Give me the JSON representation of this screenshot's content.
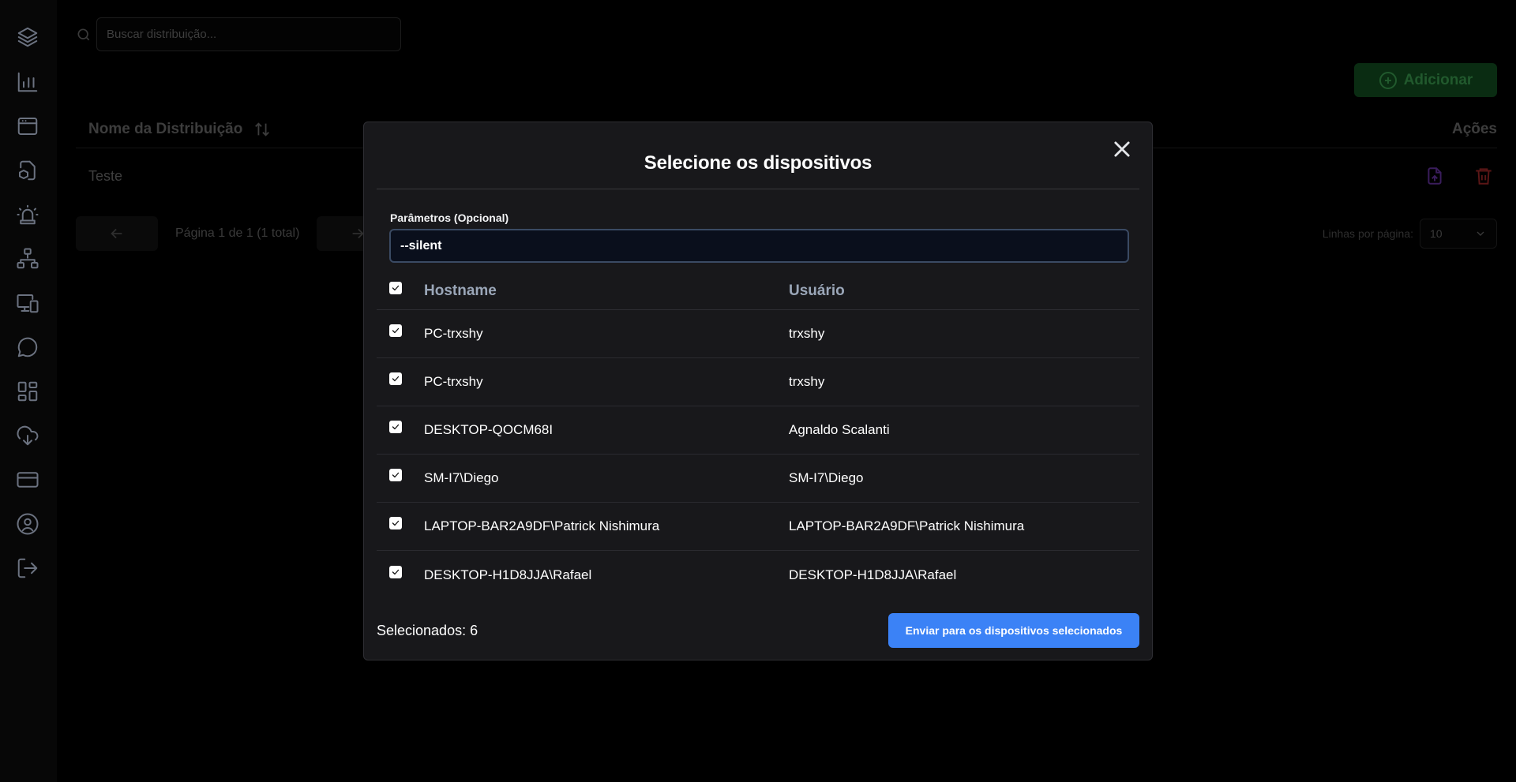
{
  "sidebar": {
    "icons": [
      "layers-icon",
      "bar-chart-icon",
      "browser-window-icon",
      "package-download-icon",
      "siren-alert-icon",
      "network-tree-icon",
      "monitor-devices-icon",
      "chat-bubble-icon",
      "dashboard-grid-icon",
      "cloud-download-icon",
      "credit-card-icon",
      "user-circle-icon",
      "logout-icon"
    ]
  },
  "search": {
    "placeholder": "Buscar distribuição..."
  },
  "add_button": {
    "label": "Adicionar",
    "color": "#22c55e"
  },
  "table": {
    "headers": {
      "name": "Nome da Distribuição",
      "actions": "Ações"
    },
    "rows": [
      {
        "name": "Teste"
      }
    ]
  },
  "pagination": {
    "text": "Página 1 de 1 (1 total)",
    "rows_label": "Linhas por página:",
    "rows_value": "10"
  },
  "modal": {
    "title": "Selecione os dispositivos",
    "param_label": "Parâmetros (Opcional)",
    "param_value": "--silent",
    "columns": {
      "hostname": "Hostname",
      "user": "Usuário"
    },
    "devices": [
      {
        "hostname": "PC-trxshy",
        "user": "trxshy",
        "checked": true
      },
      {
        "hostname": "PC-trxshy",
        "user": "trxshy",
        "checked": true
      },
      {
        "hostname": "DESKTOP-QOCM68I",
        "user": "Agnaldo Scalanti",
        "checked": true
      },
      {
        "hostname": "SM-I7\\Diego",
        "user": "SM-I7\\Diego",
        "checked": true
      },
      {
        "hostname": "LAPTOP-BAR2A9DF\\Patrick Nishimura",
        "user": "LAPTOP-BAR2A9DF\\Patrick Nishimura",
        "checked": true
      },
      {
        "hostname": "DESKTOP-H1D8JJA\\Rafael",
        "user": "DESKTOP-H1D8JJA\\Rafael",
        "checked": true
      }
    ],
    "selected_text": "Selecionados: 6",
    "send_label": "Enviar para os dispositivos selecionados",
    "accent": "#3b82f6"
  }
}
